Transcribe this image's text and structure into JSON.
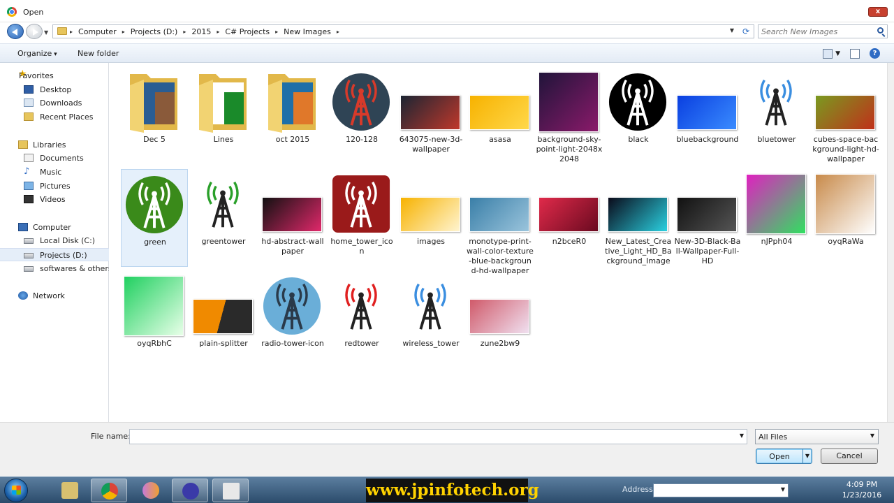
{
  "window": {
    "title": "Open",
    "close_label": "x"
  },
  "address": {
    "breadcrumbs": [
      "Computer",
      "Projects (D:)",
      "2015",
      "C# Projects",
      "New Images"
    ],
    "search_placeholder": "Search New Images"
  },
  "toolbar": {
    "organize_label": "Organize",
    "new_folder_label": "New folder",
    "help_label": "?"
  },
  "sidebar": {
    "items": [
      {
        "label": "Favorites",
        "icon": "star-icon"
      },
      {
        "label": "Desktop",
        "icon": "desktop-icon"
      },
      {
        "label": "Downloads",
        "icon": "downloads-icon"
      },
      {
        "label": "Recent Places",
        "icon": "recent-places-icon"
      },
      {
        "label": "Libraries",
        "icon": "libraries-icon"
      },
      {
        "label": "Documents",
        "icon": "documents-icon"
      },
      {
        "label": "Music",
        "icon": "music-icon"
      },
      {
        "label": "Pictures",
        "icon": "pictures-icon"
      },
      {
        "label": "Videos",
        "icon": "videos-icon"
      },
      {
        "label": "Computer",
        "icon": "computer-icon"
      },
      {
        "label": "Local Disk (C:)",
        "icon": "drive-icon"
      },
      {
        "label": "Projects (D:)",
        "icon": "drive-icon",
        "selected": true
      },
      {
        "label": "softwares & others (",
        "icon": "drive-icon"
      },
      {
        "label": "Network",
        "icon": "network-icon"
      }
    ]
  },
  "files": [
    {
      "name": "Dec 5",
      "kind": "folder",
      "colors": [
        "#2a5d93",
        "#8a5a3a"
      ]
    },
    {
      "name": "Lines",
      "kind": "folder",
      "colors": [
        "#ffffff",
        "#1a8a2a"
      ]
    },
    {
      "name": "oct 2015",
      "kind": "folder",
      "colors": [
        "#1f6fa8",
        "#e0782a"
      ]
    },
    {
      "name": "120-128",
      "kind": "tower",
      "colors": [
        "#2f4455",
        "#d83a2a"
      ]
    },
    {
      "name": "643075-new-3d-wallpaper",
      "kind": "image",
      "colors": [
        "#1b2533",
        "#c0382b"
      ]
    },
    {
      "name": "asasa",
      "kind": "image",
      "colors": [
        "#f7b200",
        "#ffd84a"
      ]
    },
    {
      "name": "background-sky-point-light-2048x2048",
      "kind": "image",
      "colors": [
        "#20143a",
        "#8a1a6a"
      ]
    },
    {
      "name": "black",
      "kind": "tower",
      "colors": [
        "#000000",
        "#ffffff"
      ]
    },
    {
      "name": "bluebackground",
      "kind": "image",
      "colors": [
        "#0a3fe0",
        "#3a8cff"
      ]
    },
    {
      "name": "bluetower",
      "kind": "tower-plain",
      "colors": [
        "#3a8ee0",
        "#222222"
      ]
    },
    {
      "name": "cubes-space-background-light-hd-wallpaper",
      "kind": "image",
      "colors": [
        "#7a9a20",
        "#c0301a"
      ]
    },
    {
      "name": "green",
      "kind": "tower",
      "colors": [
        "#3a8a1a",
        "#ffffff"
      ],
      "selected": true
    },
    {
      "name": "greentower",
      "kind": "tower-plain",
      "colors": [
        "#2aa02a",
        "#222222"
      ]
    },
    {
      "name": "hd-abstract-wallpaper",
      "kind": "image",
      "colors": [
        "#111111",
        "#e0286a"
      ]
    },
    {
      "name": "home_tower_icon",
      "kind": "tower-square",
      "colors": [
        "#9a1a1a",
        "#ffffff"
      ]
    },
    {
      "name": "images",
      "kind": "image",
      "colors": [
        "#f7b200",
        "#fff4d0"
      ]
    },
    {
      "name": "monotype-print-wall-color-texture-blue-background-hd-wallpaper",
      "kind": "image",
      "colors": [
        "#3a7fa8",
        "#9ac4dc"
      ]
    },
    {
      "name": "n2bceR0",
      "kind": "image",
      "colors": [
        "#e02a4a",
        "#6a0a20"
      ]
    },
    {
      "name": "New_Latest_Creative_Light_HD_Background_Image",
      "kind": "image",
      "colors": [
        "#0a0a1a",
        "#2ad0e0"
      ]
    },
    {
      "name": "New-3D-Black-Ball-Wallpaper-Full-HD",
      "kind": "image",
      "colors": [
        "#111111",
        "#555555"
      ]
    },
    {
      "name": "nJPph04",
      "kind": "image",
      "colors": [
        "#e020c0",
        "#30e060"
      ]
    },
    {
      "name": "oyqRaWa",
      "kind": "image",
      "colors": [
        "#c88a4a",
        "#ffffff"
      ]
    },
    {
      "name": "oyqRbhC",
      "kind": "image",
      "colors": [
        "#20d060",
        "#e8ffe8"
      ]
    },
    {
      "name": "plain-splitter",
      "kind": "image",
      "colors": [
        "#f08a00",
        "#2a2a2a"
      ]
    },
    {
      "name": "radio-tower-icon",
      "kind": "tower",
      "colors": [
        "#6aaed8",
        "#2a3a4a"
      ]
    },
    {
      "name": "redtower",
      "kind": "tower-plain",
      "colors": [
        "#e02020",
        "#222222"
      ]
    },
    {
      "name": "wireless_tower",
      "kind": "tower-plain",
      "colors": [
        "#3a8ee0",
        "#222222"
      ]
    },
    {
      "name": "zune2bw9",
      "kind": "image",
      "colors": [
        "#d05a6a",
        "#f0e0f0"
      ]
    }
  ],
  "footer": {
    "filename_label": "File name:",
    "filename_value": "",
    "filetype_value": "All Files",
    "open_label": "Open",
    "cancel_label": "Cancel"
  },
  "taskbar": {
    "brand_text": "www.jpinfotech.org",
    "address_label": "Address",
    "time": "4:09 PM",
    "date": "1/23/2016"
  }
}
